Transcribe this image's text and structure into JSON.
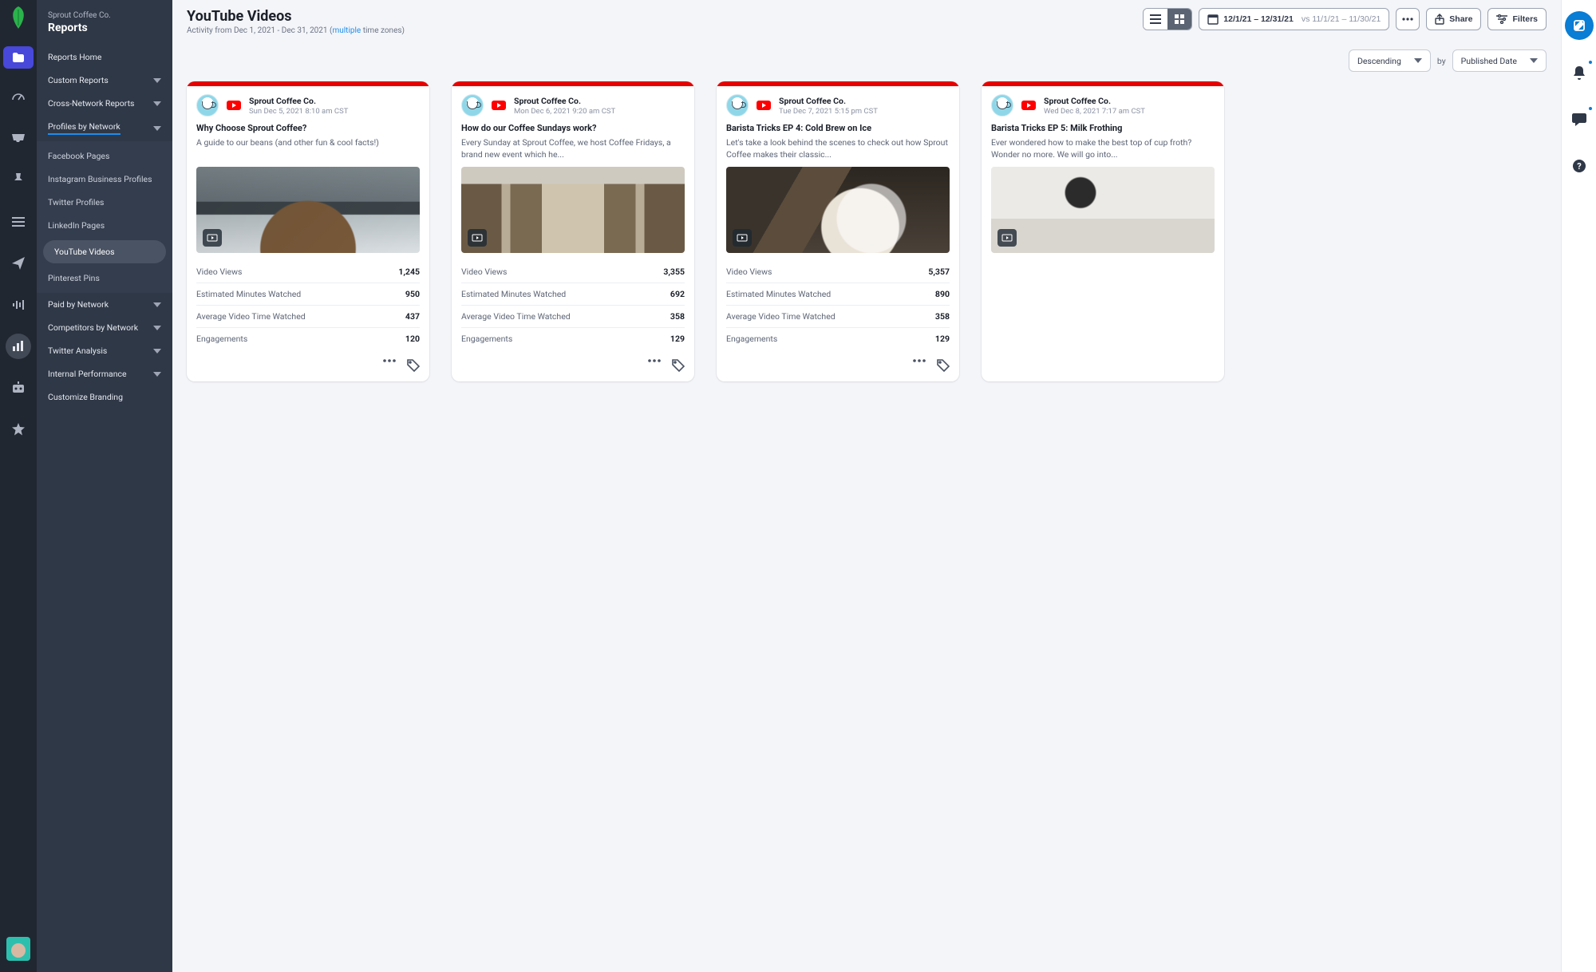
{
  "org": "Sprout Coffee Co.",
  "section": "Reports",
  "page_title": "YouTube Videos",
  "activity_line_prefix": "Activity from Dec 1, 2021 - Dec 31, 2021 (",
  "activity_link": "multiple",
  "activity_line_suffix": " time zones)",
  "date_range": "12/1/21 – 12/31/21",
  "date_compare": "vs 11/1/21 – 11/30/21",
  "share_label": "Share",
  "filters_label": "Filters",
  "sort": {
    "direction": "Descending",
    "by_label": "by",
    "field": "Published Date"
  },
  "sidebar": {
    "items": [
      {
        "label": "Reports Home",
        "chevron": false
      },
      {
        "label": "Custom Reports",
        "chevron": true
      },
      {
        "label": "Cross-Network Reports",
        "chevron": true
      },
      {
        "label": "Profiles by Network",
        "chevron": true,
        "selected": true,
        "children": [
          {
            "label": "Facebook Pages"
          },
          {
            "label": "Instagram Business Profiles"
          },
          {
            "label": "Twitter Profiles"
          },
          {
            "label": "LinkedIn Pages"
          },
          {
            "label": "YouTube Videos",
            "active": true
          },
          {
            "label": "Pinterest Pins"
          }
        ]
      },
      {
        "label": "Paid by Network",
        "chevron": true
      },
      {
        "label": "Competitors by Network",
        "chevron": true
      },
      {
        "label": "Twitter Analysis",
        "chevron": true
      },
      {
        "label": "Internal Performance",
        "chevron": true
      },
      {
        "label": "Customize Branding",
        "chevron": false
      }
    ]
  },
  "stat_labels": [
    "Video Views",
    "Estimated Minutes Watched",
    "Average Video Time Watched",
    "Engagements"
  ],
  "cards": [
    {
      "name": "Sprout Coffee Co.",
      "time": "Sun Dec 5, 2021 8:10 am CST",
      "title": "Why Choose Sprout Coffee?",
      "desc": "A guide to our beans (and other fun & cool facts!)",
      "thumb": "th-1",
      "stats": [
        "1,245",
        "950",
        "437",
        "120"
      ]
    },
    {
      "name": "Sprout Coffee Co.",
      "time": "Mon Dec 6, 2021 9:20 am CST",
      "title": "How do our Coffee Sundays work?",
      "desc": "Every Sunday at Sprout Coffee, we host Coffee Fridays, a brand new event which he...",
      "thumb": "th-2",
      "stats": [
        "3,355",
        "692",
        "358",
        "129"
      ]
    },
    {
      "name": "Sprout Coffee Co.",
      "time": "Tue Dec 7, 2021 5:15 pm CST",
      "title": "Barista Tricks EP 4: Cold Brew on Ice",
      "desc": "Let's take a look behind the scenes to check out how Sprout Coffee makes their classic...",
      "thumb": "th-3",
      "stats": [
        "5,357",
        "890",
        "358",
        "129"
      ]
    },
    {
      "name": "Sprout Coffee Co.",
      "time": "Wed Dec 8, 2021 7:17 am CST",
      "title": "Barista Tricks EP 5: Milk Frothing",
      "desc": "Ever wondered how to make the best top of cup froth? Wonder no more. We will go into...",
      "thumb": "th-4",
      "stats": [
        "",
        "",
        "",
        ""
      ],
      "partial": true
    }
  ]
}
